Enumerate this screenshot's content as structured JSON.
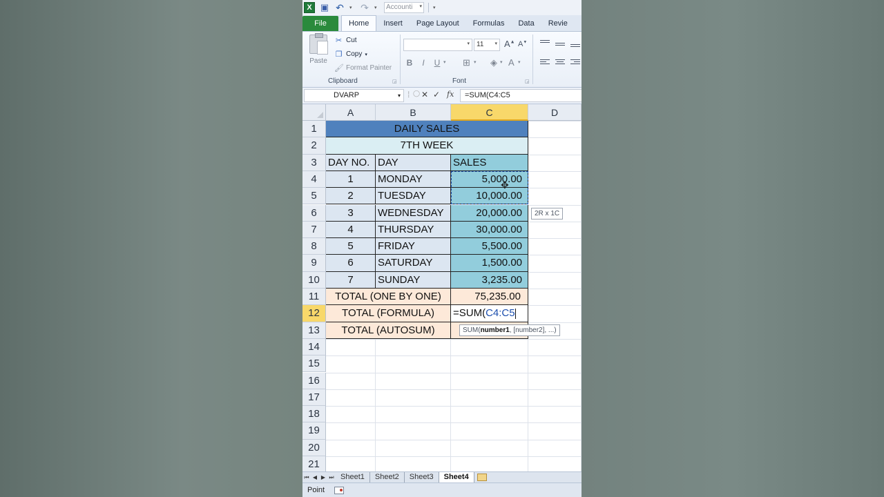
{
  "qat": {
    "style_combo": "Accounti"
  },
  "tabs": [
    "File",
    "Home",
    "Insert",
    "Page Layout",
    "Formulas",
    "Data",
    "Revie"
  ],
  "ribbon": {
    "paste_label": "Paste",
    "cut_label": "Cut",
    "copy_label": "Copy",
    "format_painter_label": "Format Painter",
    "clipboard_group": "Clipboard",
    "font_size": "11",
    "font_group": "Font"
  },
  "formula_bar": {
    "name_box": "DVARP",
    "fx": "fx",
    "formula": "=SUM(C4:C5"
  },
  "columns": [
    "A",
    "B",
    "C",
    "D"
  ],
  "rows": [
    "1",
    "2",
    "3",
    "4",
    "5",
    "6",
    "7",
    "8",
    "9",
    "10",
    "11",
    "12",
    "13",
    "14",
    "15",
    "16",
    "17",
    "18",
    "19",
    "20",
    "21"
  ],
  "table": {
    "title": "DAILY SALES",
    "week": "7TH WEEK",
    "headers": [
      "DAY NO.",
      "DAY",
      "SALES"
    ],
    "data": [
      {
        "no": "1",
        "day": "MONDAY",
        "sales": "5,000.00"
      },
      {
        "no": "2",
        "day": "TUESDAY",
        "sales": "10,000.00"
      },
      {
        "no": "3",
        "day": "WEDNESDAY",
        "sales": "20,000.00"
      },
      {
        "no": "4",
        "day": "THURSDAY",
        "sales": "30,000.00"
      },
      {
        "no": "5",
        "day": "FRIDAY",
        "sales": "5,500.00"
      },
      {
        "no": "6",
        "day": "SATURDAY",
        "sales": "1,500.00"
      },
      {
        "no": "7",
        "day": "SUNDAY",
        "sales": "3,235.00"
      }
    ],
    "total_one_by_one_label": "TOTAL (ONE BY ONE)",
    "total_one_by_one_value": "75,235.00",
    "total_formula_label": "TOTAL (FORMULA)",
    "total_formula_edit_prefix": "=SUM(",
    "total_formula_edit_range": "C4:C5",
    "total_autosum_label": "TOTAL (AUTOSUM)"
  },
  "tooltips": {
    "range_size": "2R x 1C",
    "sum_fn": "SUM(",
    "sum_arg1": "number1",
    "sum_rest": ", [number2], ...)"
  },
  "sheets": [
    "Sheet1",
    "Sheet2",
    "Sheet3",
    "Sheet4"
  ],
  "active_sheet": "Sheet4",
  "status": "Point",
  "colors": {
    "title_fill": "#4f81bd",
    "week_fill": "#daeef3",
    "body_fill": "#dce6f1",
    "sales_fill": "#92cddc",
    "total_fill": "#fde9d9",
    "selected_header": "#f8d86a",
    "range_ref": "#1d4fae"
  }
}
